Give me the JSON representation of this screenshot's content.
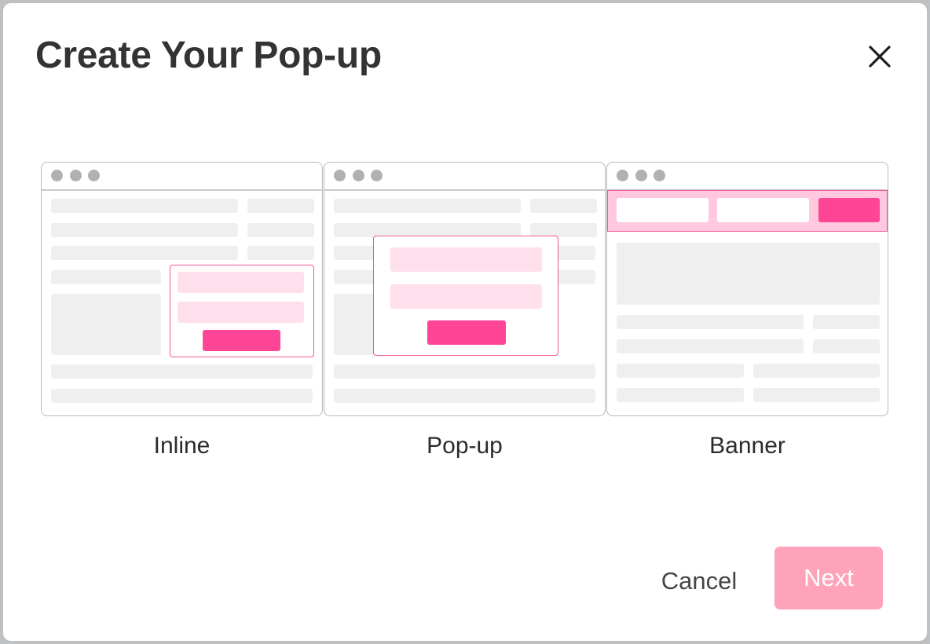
{
  "dialog": {
    "title": "Create Your Pop-up",
    "close_icon": "close-icon"
  },
  "options": [
    {
      "id": "inline",
      "label": "Inline",
      "selected": false
    },
    {
      "id": "popup",
      "label": "Pop-up",
      "selected": false
    },
    {
      "id": "banner",
      "label": "Banner",
      "selected": false
    }
  ],
  "footer": {
    "cancel_label": "Cancel",
    "next_label": "Next",
    "next_disabled": true
  },
  "colors": {
    "accent": "#ff4596",
    "accent_light": "#ffdfec",
    "banner_bg": "#ffc8de",
    "accent_border": "#f0559a",
    "next_disabled_bg": "#ffa3bb",
    "overlay": "#bfc0c2"
  }
}
